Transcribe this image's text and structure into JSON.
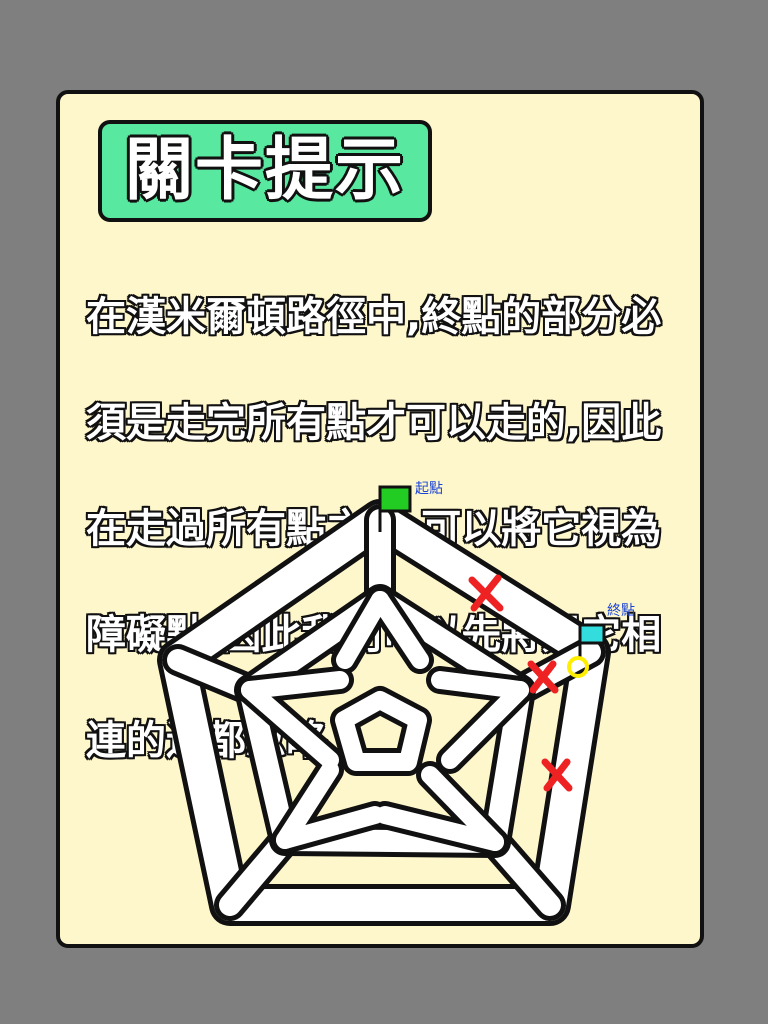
{
  "panel": {
    "title": "關卡提示",
    "hint_lines": [
      "在漢米爾頓路徑中,終點的部分必",
      "須是走完所有點才可以走的,因此",
      "在走過所有點之前,可以將它視為",
      "障礙點,因此我們可以先將與它相",
      "連的邊都忽略"
    ]
  },
  "diagram": {
    "start_label": "起點",
    "end_label": "終點",
    "start_flag_color": "#22cc22",
    "end_flag_color": "#33dddd",
    "end_marker_color": "#ffee00",
    "cross_color": "#ee2222",
    "ignored_edges_count": 3
  },
  "colors": {
    "background": "#7f7f7f",
    "card": "#fff7cc",
    "title_badge": "#58e89f",
    "text_fill": "#ffffff",
    "outline": "#111111"
  }
}
